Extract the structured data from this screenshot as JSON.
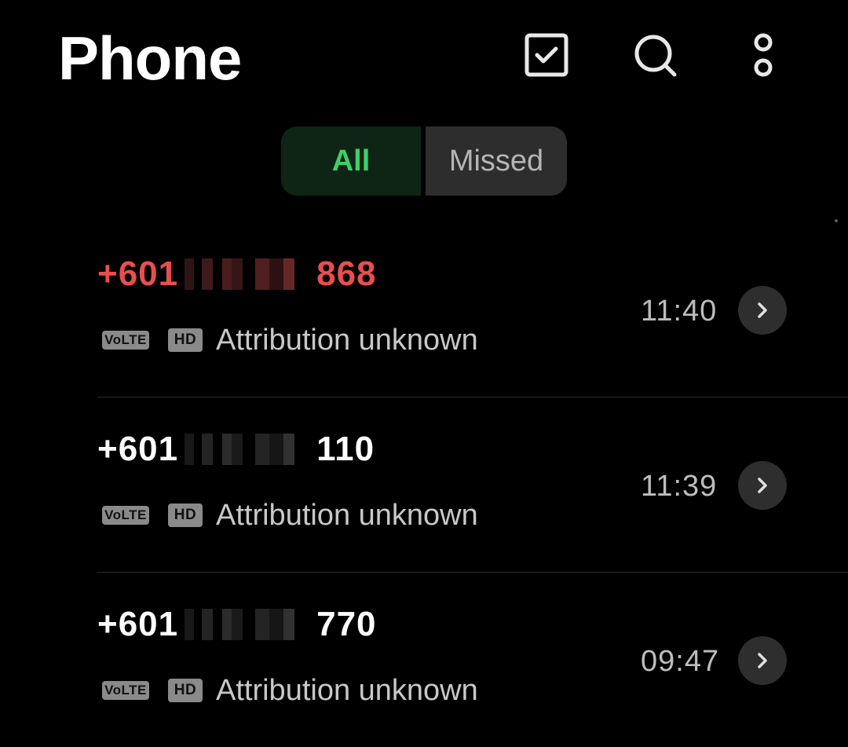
{
  "header": {
    "title": "Phone",
    "icons": [
      "select-icon",
      "search-icon",
      "more-options-icon"
    ]
  },
  "filter": {
    "all_label": "All",
    "missed_label": "Missed",
    "selected": "All"
  },
  "calls": [
    {
      "number_prefix": "+601",
      "number_suffix": "868",
      "missed": true,
      "tag_volte": "VoLTE",
      "tag_hd": "HD",
      "attribution": "Attribution unknown",
      "time": "11:40"
    },
    {
      "number_prefix": "+601",
      "number_suffix": "110",
      "missed": false,
      "tag_volte": "VoLTE",
      "tag_hd": "HD",
      "attribution": "Attribution unknown",
      "time": "11:39"
    },
    {
      "number_prefix": "+601",
      "number_suffix": "770",
      "missed": false,
      "tag_volte": "VoLTE",
      "tag_hd": "HD",
      "attribution": "Attribution unknown",
      "time": "09:47"
    }
  ],
  "colors": {
    "background": "#000000",
    "accent_green": "#3fcf6a",
    "missed_red": "#e94e4e",
    "secondary_text": "#c8c8c8"
  }
}
